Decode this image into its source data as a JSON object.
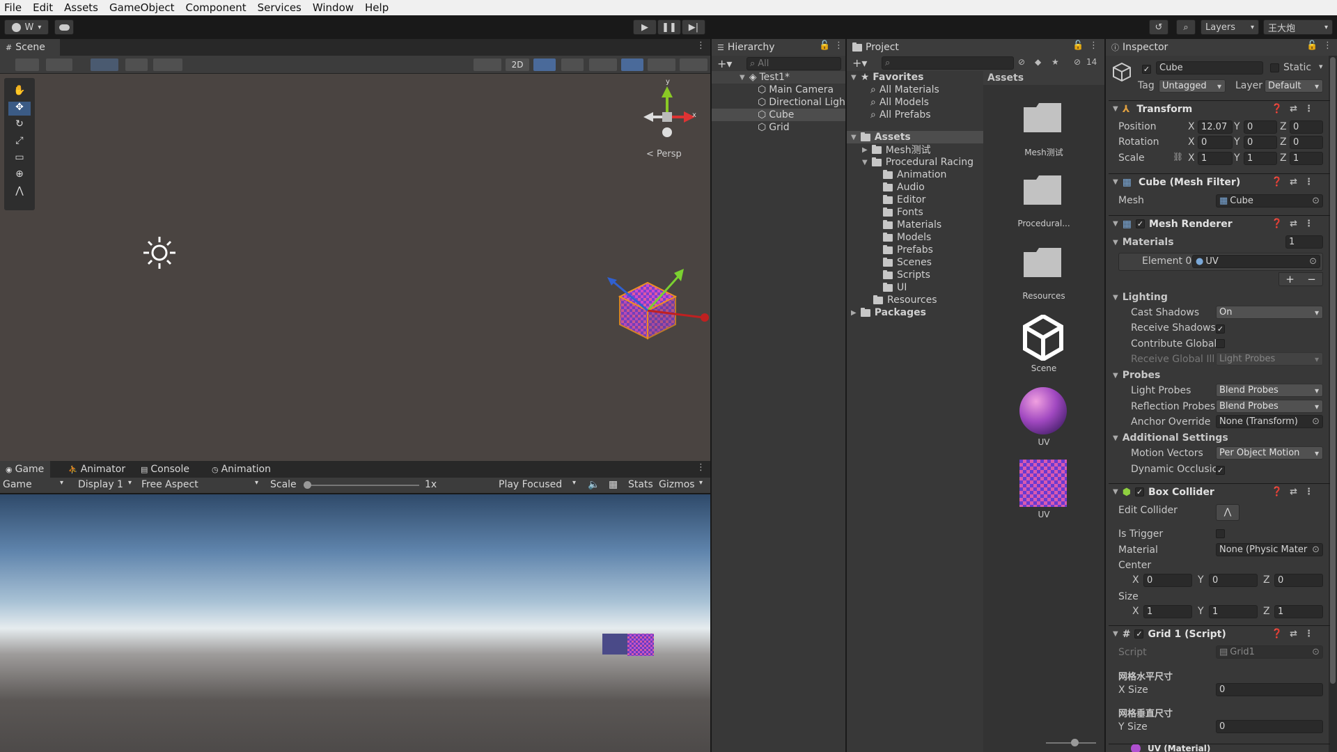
{
  "menubar": {
    "items": [
      "File",
      "Edit",
      "Assets",
      "GameObject",
      "Component",
      "Services",
      "Window",
      "Help"
    ]
  },
  "toolbar": {
    "account_label": "W",
    "layers_label": "Layers",
    "layout_label": "王大炮"
  },
  "scene": {
    "tab_label": "Scene",
    "btn_2d": "2D",
    "persp_label": "< Persp",
    "gizmo_y": "y",
    "gizmo_x": "x"
  },
  "game": {
    "tabs": [
      "Game",
      "Animator",
      "Console",
      "Animation"
    ],
    "display_mode": "Game",
    "display": "Display 1",
    "aspect": "Free Aspect",
    "scale_label": "Scale",
    "scale_value": "1x",
    "play_mode": "Play Focused",
    "stats": "Stats",
    "gizmos": "Gizmos"
  },
  "hierarchy": {
    "tab_label": "Hierarchy",
    "search_placeholder": "All",
    "scene_name": "Test1*",
    "items": [
      "Main Camera",
      "Directional Ligh",
      "Cube",
      "Grid"
    ]
  },
  "project": {
    "tab_label": "Project",
    "hidden_count": "14",
    "favorites_label": "Favorites",
    "favorites": [
      "All Materials",
      "All Models",
      "All Prefabs"
    ],
    "assets_label": "Assets",
    "assets_children": [
      "Mesh测试",
      "Procedural Racing"
    ],
    "racing_children": [
      "Animation",
      "Audio",
      "Editor",
      "Fonts",
      "Materials",
      "Models",
      "Prefabs",
      "Scenes",
      "Scripts",
      "UI"
    ],
    "resources": "Resources",
    "packages": "Packages",
    "grid_header": "Assets",
    "grid_items": [
      "Mesh测试",
      "Procedural...",
      "Resources",
      "Scene",
      "UV",
      "UV"
    ]
  },
  "inspector": {
    "tab_label": "Inspector",
    "object_name": "Cube",
    "static_label": "Static",
    "tag_label": "Tag",
    "tag_value": "Untagged",
    "layer_label": "Layer",
    "layer_value": "Default",
    "transform": {
      "title": "Transform",
      "position_label": "Position",
      "position": [
        "12.07",
        "0",
        "0"
      ],
      "rotation_label": "Rotation",
      "rotation": [
        "0",
        "0",
        "0"
      ],
      "scale_label": "Scale",
      "scale": [
        "1",
        "1",
        "1"
      ]
    },
    "mesh_filter": {
      "title": "Cube (Mesh Filter)",
      "mesh_label": "Mesh",
      "mesh_value": "Cube"
    },
    "mesh_renderer": {
      "title": "Mesh Renderer",
      "materials_label": "Materials",
      "materials_count": "1",
      "element0_label": "Element 0",
      "element0_value": "UV",
      "lighting_label": "Lighting",
      "cast_shadows_label": "Cast Shadows",
      "cast_shadows_value": "On",
      "receive_shadows_label": "Receive Shadows",
      "contribute_gi_label": "Contribute Global",
      "receive_gi_label": "Receive Global Ill",
      "receive_gi_value": "Light Probes",
      "probes_label": "Probes",
      "light_probes_label": "Light Probes",
      "light_probes_value": "Blend Probes",
      "reflection_probes_label": "Reflection Probes",
      "reflection_probes_value": "Blend Probes",
      "anchor_label": "Anchor Override",
      "anchor_value": "None (Transform)",
      "additional_label": "Additional Settings",
      "motion_vectors_label": "Motion Vectors",
      "motion_vectors_value": "Per Object Motion",
      "dynamic_occlusion_label": "Dynamic Occlusic"
    },
    "box_collider": {
      "title": "Box Collider",
      "edit_label": "Edit Collider",
      "trigger_label": "Is Trigger",
      "material_label": "Material",
      "material_value": "None (Physic Mater",
      "center_label": "Center",
      "center": [
        "0",
        "0",
        "0"
      ],
      "size_label": "Size",
      "size": [
        "1",
        "1",
        "1"
      ]
    },
    "grid_script": {
      "title": "Grid 1 (Script)",
      "script_label": "Script",
      "script_value": "Grid1",
      "h_header": "网格水平尺寸",
      "x_size_label": "X Size",
      "x_size_value": "0",
      "v_header": "网格垂直尺寸",
      "y_size_label": "Y Size",
      "y_size_value": "0"
    },
    "next_component": "UV (Material)"
  },
  "xyz": {
    "x": "X",
    "y": "Y",
    "z": "Z"
  }
}
